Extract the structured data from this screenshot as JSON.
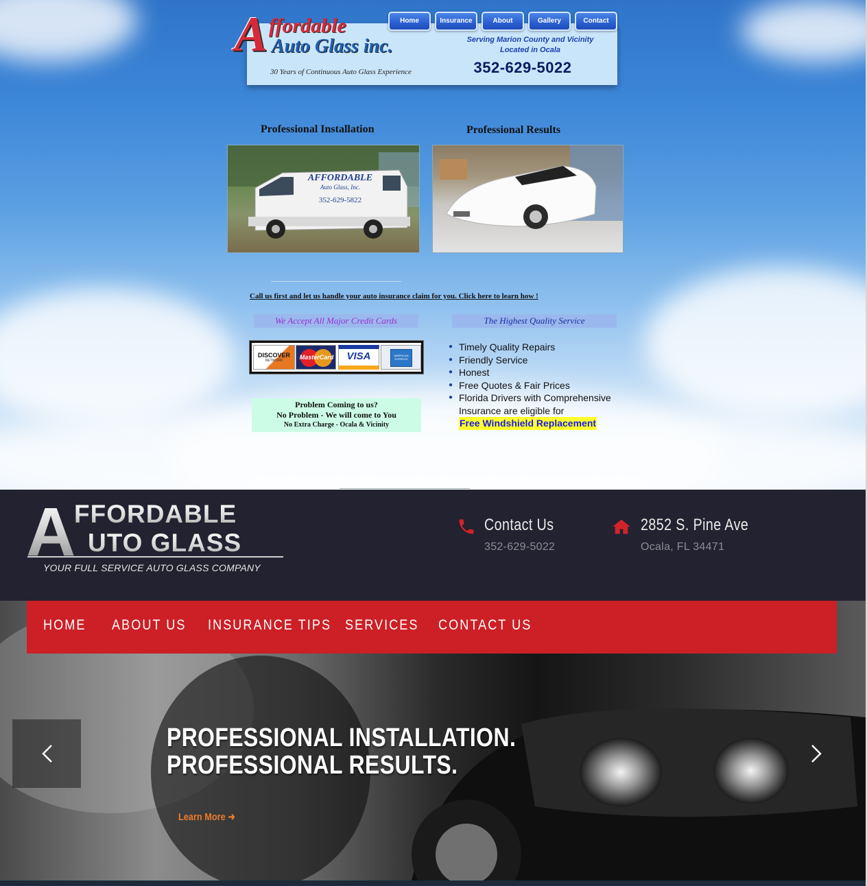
{
  "old_site": {
    "logo": {
      "initial": "A",
      "line1": "ffordable",
      "line2": "Auto Glass inc."
    },
    "tagline": "30 Years of Continuous Auto Glass Experience",
    "serving_line1": "Serving Marion County and Vicinity",
    "serving_line2": "Located in Ocala",
    "phone": "352-629-5022",
    "nav": [
      {
        "label": "Home"
      },
      {
        "label": "Insurance"
      },
      {
        "label": "About"
      },
      {
        "label": "Gallery"
      },
      {
        "label": "Contact"
      }
    ],
    "section_left_heading": "Professional Installation",
    "section_right_heading": "Professional Results",
    "van_text_lines": [
      "AFFORDABLE",
      "Auto Glass, Inc.",
      "352-629-5822"
    ],
    "insurance_link": "Call us first and let us handle your auto insurance claim for you.  Click here to learn how !",
    "credit_label": "We Accept All Major Credit Cards",
    "quality_label": "The Highest Quality Service",
    "cards": [
      {
        "name": "DISCOVER",
        "sub": "NETWORK"
      },
      {
        "name": "MasterCard"
      },
      {
        "name": "VISA"
      },
      {
        "name": "AMERICAN EXPRESS"
      }
    ],
    "problem_box": {
      "line1": "Problem Coming to us?",
      "line2": "No Problem - We will come to You",
      "line3": "No Extra Charge - Ocala & Vicinity"
    },
    "quality_items": [
      "Timely Quality Repairs",
      "Friendly Service",
      "Honest",
      "Free Quotes & Fair Prices",
      "Florida Drivers with Comprehensive Insurance are eligible for"
    ],
    "free_windshield": "Free Windshield Replacement"
  },
  "new_site": {
    "brand": {
      "initial": "A",
      "line1": "FFORDABLE",
      "line2": "UTO GLASS",
      "tagline": "YOUR FULL SERVICE AUTO GLASS COMPANY"
    },
    "contact": {
      "title": "Contact Us",
      "phone": "352-629-5022"
    },
    "address": {
      "street": "2852 S. Pine Ave",
      "city": "Ocala, FL 34471"
    },
    "nav": [
      {
        "label": "HOME"
      },
      {
        "label": "ABOUT US"
      },
      {
        "label": "INSURANCE TIPS"
      },
      {
        "label": "SERVICES"
      },
      {
        "label": "CONTACT US"
      }
    ],
    "hero": {
      "line1": "PROFESSIONAL INSTALLATION.",
      "line2": "PROFESSIONAL RESULTS.",
      "cta": "Learn More"
    },
    "colors": {
      "accent_red": "#cc1f26",
      "header_bg": "#222230",
      "cta_orange": "#ec7a2a"
    }
  }
}
